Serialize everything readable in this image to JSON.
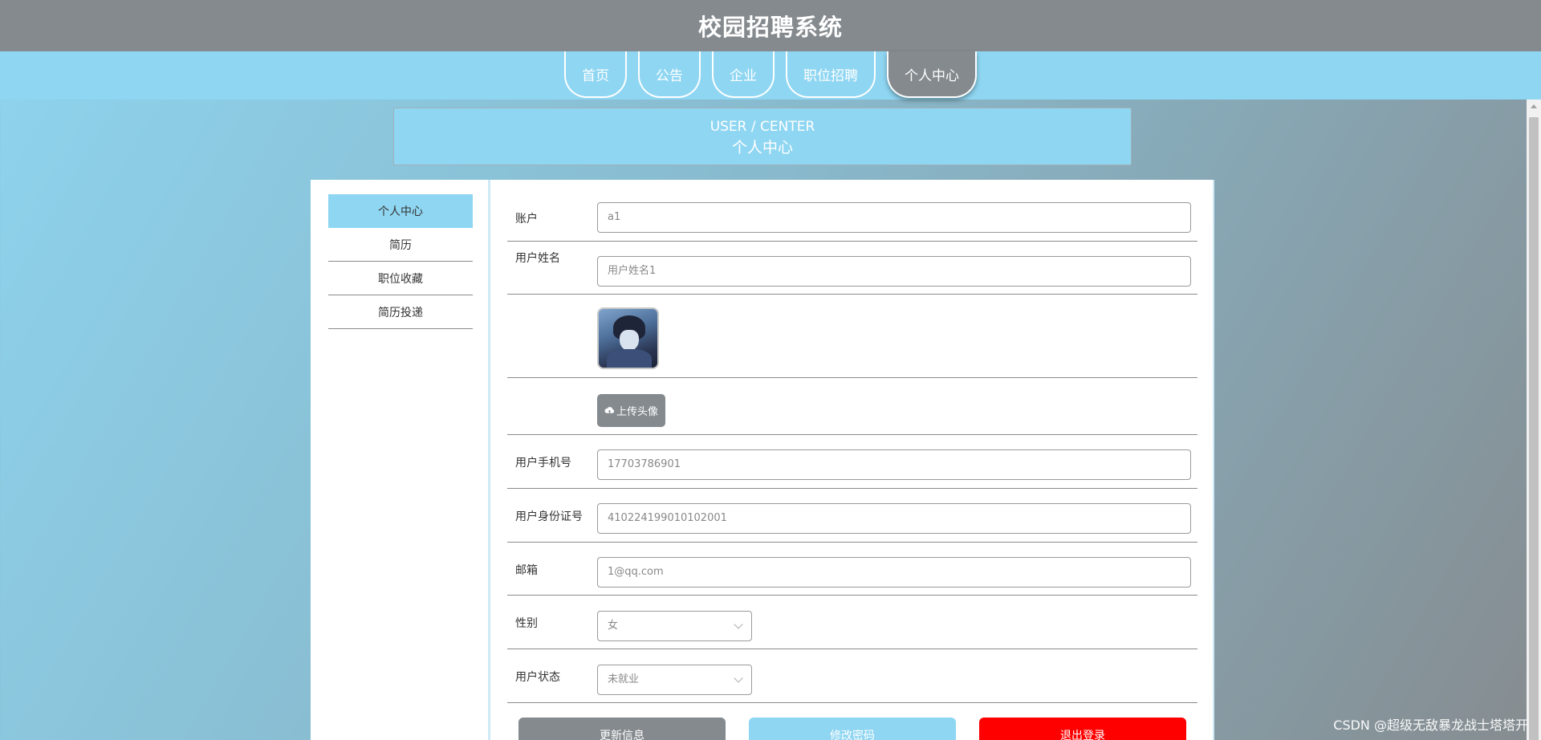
{
  "header": {
    "title": "校园招聘系统"
  },
  "nav": {
    "tabs": [
      {
        "label": "首页"
      },
      {
        "label": "公告"
      },
      {
        "label": "企业"
      },
      {
        "label": "职位招聘"
      },
      {
        "label": "个人中心"
      }
    ],
    "active": "个人中心"
  },
  "banner": {
    "en": "USER / CENTER",
    "cn": "个人中心"
  },
  "sidebar": {
    "items": [
      {
        "label": "个人中心"
      },
      {
        "label": "简历"
      },
      {
        "label": "职位收藏"
      },
      {
        "label": "简历投递"
      }
    ]
  },
  "form": {
    "account": {
      "label": "账户",
      "value": "a1"
    },
    "username": {
      "label": "用户姓名",
      "value": "用户姓名1"
    },
    "upload": {
      "label": "上传头像"
    },
    "phone": {
      "label": "用户手机号",
      "value": "17703786901"
    },
    "idcard": {
      "label": "用户身份证号",
      "value": "410224199010102001"
    },
    "email": {
      "label": "邮箱",
      "value": "1@qq.com"
    },
    "gender": {
      "label": "性别",
      "value": "女"
    },
    "status": {
      "label": "用户状态",
      "value": "未就业"
    }
  },
  "actions": {
    "update": "更新信息",
    "change_password": "修改密码",
    "logout": "退出登录"
  },
  "colors": {
    "header_bg": "#848a8e",
    "nav_bg": "#8fd6f2",
    "accent": "#8fd6f2",
    "danger": "#ff0000"
  },
  "watermark": "CSDN @超级无敌暴龙战士塔塔开"
}
